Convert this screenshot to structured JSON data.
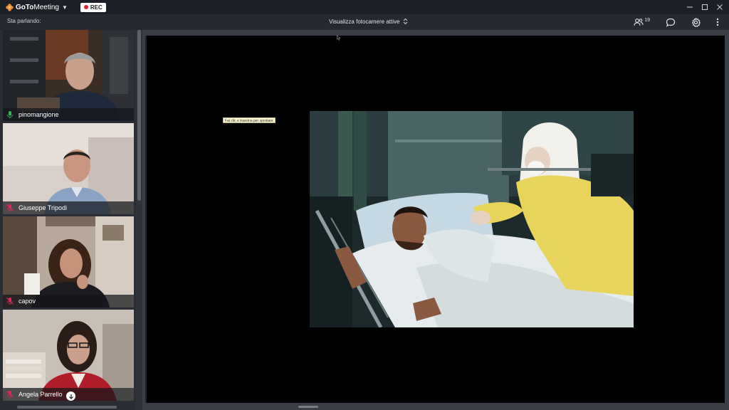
{
  "app": {
    "name_part1": "GoTo",
    "name_part2": "Meeting",
    "rec_label": "REC"
  },
  "subheader": {
    "speaking_label": "Sta parlando:",
    "camera_view_label": "Visualizza fotocamere attive",
    "participant_count": "19"
  },
  "participants": [
    {
      "name": "pinomangione",
      "mic": "on"
    },
    {
      "name": "Giuseppe Tripodi",
      "mic": "muted"
    },
    {
      "name": "capov",
      "mic": "muted"
    },
    {
      "name": "Angela Parrello",
      "mic": "muted"
    }
  ],
  "stage": {
    "tooltip": "Fai clic e trascina per spostare"
  },
  "icons": {
    "logo": "gotomeeting-flower-icon",
    "participants": "people-icon",
    "chat": "chat-bubble-icon",
    "settings": "gear-icon",
    "more": "more-vertical-icon",
    "minimize": "minimize-icon",
    "maximize": "maximize-icon",
    "close": "close-icon"
  },
  "colors": {
    "accent_orange": "#f68d2e",
    "mic_on": "#3cb55a",
    "mic_muted": "#e0245e",
    "rec_dot": "#d7262e"
  }
}
